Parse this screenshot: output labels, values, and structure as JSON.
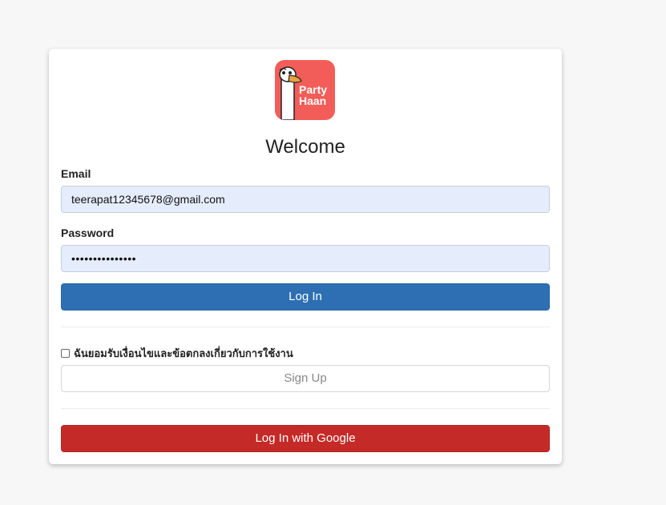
{
  "logo": {
    "line1": "Party",
    "line2": "Haan",
    "bg_color": "#f25d59"
  },
  "heading": "Welcome",
  "email": {
    "label": "Email",
    "value": "teerapat12345678@gmail.com"
  },
  "password": {
    "label": "Password",
    "value": "•••••••••••••••"
  },
  "login_button": "Log In",
  "terms_label": "ฉันยอมรับเงื่อนไขและข้อตกลงเกี่ยวกับการใช้งาน",
  "signup_button": "Sign Up",
  "google_button": "Log In with Google",
  "colors": {
    "primary": "#2d6fb2",
    "google": "#c42a27",
    "input_bg": "#e5edfd"
  }
}
